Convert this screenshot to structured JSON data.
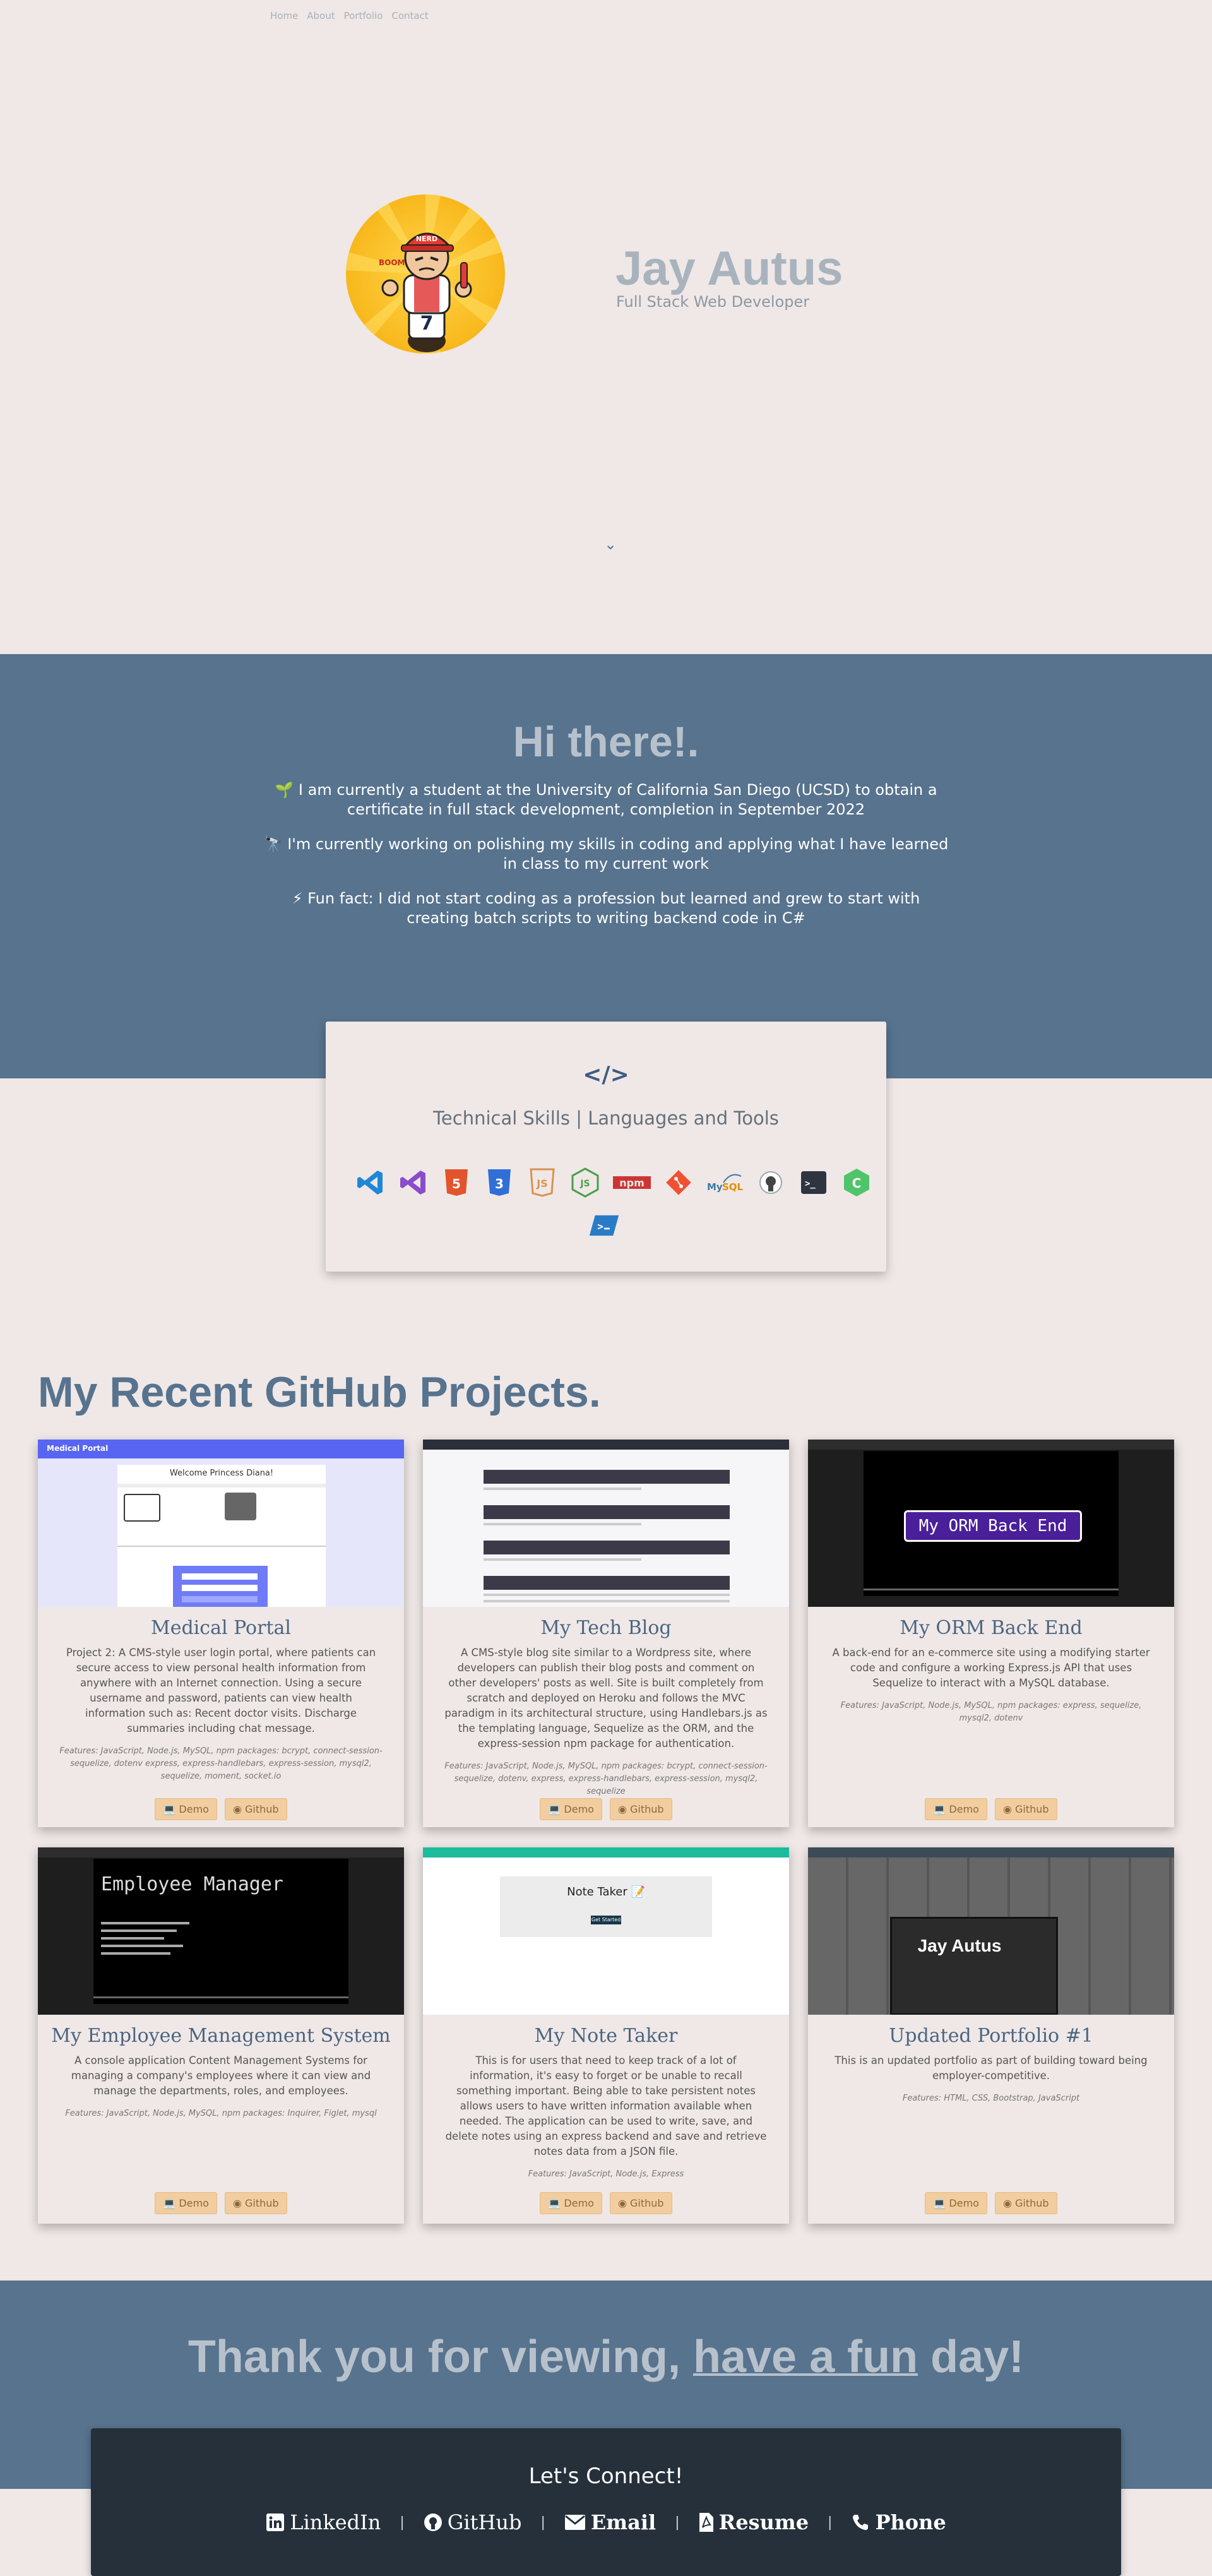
{
  "nav": {
    "home": "Home",
    "about": "About",
    "portfolio": "Portfolio",
    "contact": "Contact"
  },
  "hero": {
    "name": "Jay Autus",
    "subtitle": "Full Stack Web Developer",
    "scroll_arrow": "⌄"
  },
  "about": {
    "title": "Hi there!.",
    "p1": "🌱 I am currently a student at the University of California San Diego (UCSD) to obtain a certificate in full stack development, completion in September 2022",
    "p2": "🔭 I'm currently working on polishing my skills in coding and applying what I have learned in class to my current work",
    "p3": "⚡ Fun fact: I did not start coding as a profession but learned and grew to start with creating batch scripts to writing backend code in C#"
  },
  "skills": {
    "icon": "code-icon",
    "title": "Technical Skills | Languages and Tools",
    "tools": [
      "vscode-icon",
      "visualstudio-icon",
      "html5-icon",
      "css3-icon",
      "javascript-icon",
      "nodejs-icon",
      "npm-icon",
      "git-icon",
      "mysql-icon",
      "github-icon",
      "terminal-icon",
      "csharp-icon",
      "powershell-icon"
    ]
  },
  "projects": {
    "title": "My Recent GitHub Projects.",
    "demo_label": "💻 Demo",
    "github_label": "Github",
    "items": [
      {
        "title": "Medical Portal",
        "desc": "Project 2: A CMS-style user login portal, where patients can secure access to view personal health information from anywhere with an Internet connection. Using a secure username and password, patients can view health information such as: Recent doctor visits. Discharge summaries including chat message.",
        "features": "Features: JavaScript, Node.js, MySQL, npm packages: bcrypt, connect-session-sequelize, dotenv express, express-handlebars, express-session, mysql2, sequelize, moment, socket.io"
      },
      {
        "title": "My Tech Blog",
        "desc": "A CMS-style blog site similar to a Wordpress site, where developers can publish their blog posts and comment on other developers' posts as well. Site is built completely from scratch and deployed on Heroku and follows the MVC paradigm in its architectural structure, using Handlebars.js as the templating language, Sequelize as the ORM, and the express-session npm package for authentication.",
        "features": "Features: JavaScript, Node.js, MySQL, npm packages: bcrypt, connect-session-sequelize, dotenv, express, express-handlebars, express-session, mysql2, sequelize"
      },
      {
        "title": "My ORM Back End",
        "desc": "A back-end for an e-commerce site using a modifying starter code and configure a working Express.js API that uses Sequelize to interact with a MySQL database.",
        "features": "Features: JavaScript, Node.js, MySQL, npm packages: express, sequelize, mysql2, dotenv"
      },
      {
        "title": "My Employee Management System",
        "desc": "A console application Content Management Systems for managing a company's employees where it can view and manage the departments, roles, and employees.",
        "features": "Features: JavaScript, Node.js, MySQL, npm packages: Inquirer, Figlet, mysql"
      },
      {
        "title": "My Note Taker",
        "desc": "This is for users that need to keep track of a lot of information, it's easy to forget or be unable to recall something important. Being able to take persistent notes allows users to have written information available when needed. The application can be used to write, save, and delete notes using an express backend and save and retrieve notes data from a JSON file.",
        "features": "Features: JavaScript, Node.js, Express"
      },
      {
        "title": "Updated Portfolio #1",
        "desc": "This is an updated portfolio as part of building toward being employer-competitive.",
        "features": "Features: HTML, CSS, Bootstrap, JavaScript"
      }
    ],
    "thumbs": {
      "medical_header": "Medical Portal",
      "medical_welcome": "Welcome Princess Diana!",
      "orm_banner": "My ORM Back End",
      "employee_banner": "Employee Manager",
      "note_title": "Note Taker 📝",
      "note_button": "Get Started",
      "portfolio_name": "Jay Autus"
    }
  },
  "thanks": {
    "prefix": "Thank you for viewing, ",
    "underlined": "have a fun",
    "suffix": " day!"
  },
  "footer": {
    "connect": "Let's Connect!",
    "linkedin": "LinkedIn",
    "github": "GitHub",
    "email": "Email",
    "resume": "Resume",
    "phone": "Phone",
    "separator": "|"
  },
  "colors": {
    "accent": "#57738e",
    "background": "#efe8e7",
    "button": "#f1cd9f",
    "footer": "#25303a"
  }
}
